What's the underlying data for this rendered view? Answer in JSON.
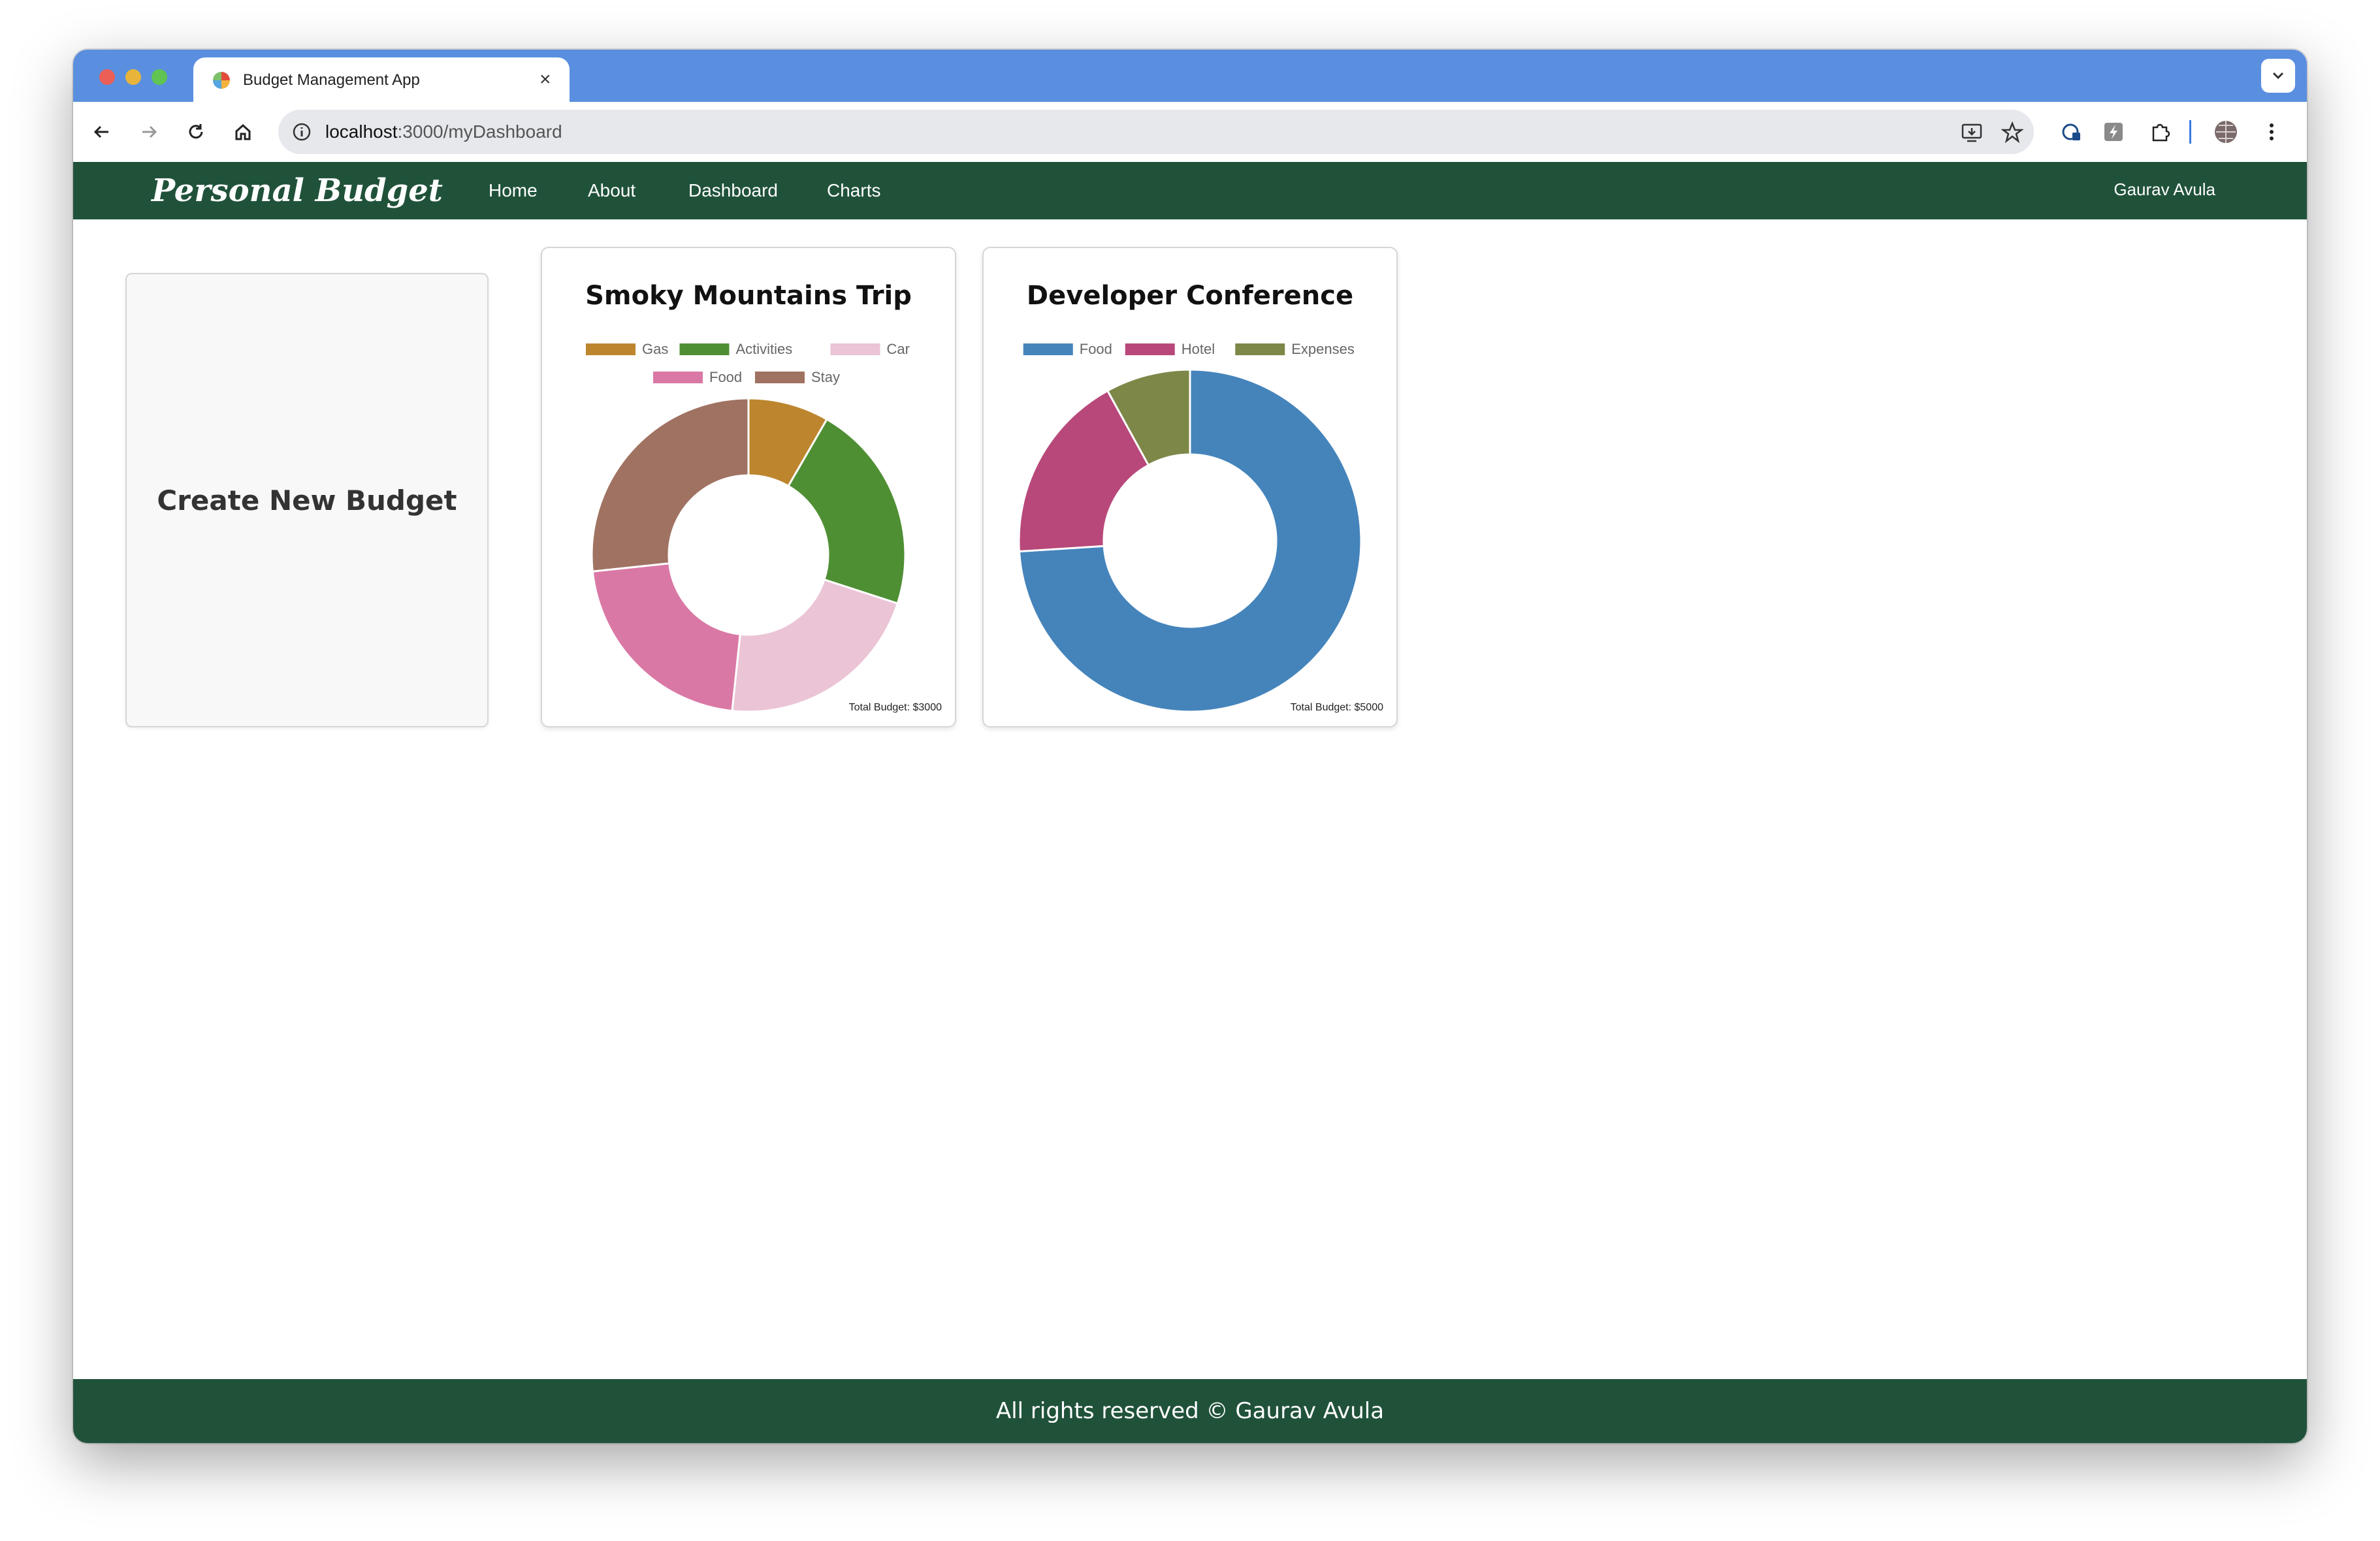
{
  "browser": {
    "tab_title": "Budget Management App",
    "url_host": "localhost",
    "url_path": ":3000/myDashboard"
  },
  "navbar": {
    "brand": "Personal Budget",
    "links": [
      "Home",
      "About",
      "Dashboard",
      "Charts"
    ],
    "user": "Gaurav Avula"
  },
  "create_card": {
    "label": "Create New Budget"
  },
  "budgets": [
    {
      "title": "Smoky Mountains Trip",
      "total": "Total Budget: $3000"
    },
    {
      "title": "Developer Conference",
      "total": "Total Budget: $5000"
    }
  ],
  "chart_data": [
    {
      "type": "pie",
      "title": "Smoky Mountains Trip",
      "categories": [
        "Gas",
        "Activities",
        "Car",
        "Food",
        "Stay"
      ],
      "values": [
        250,
        650,
        650,
        650,
        800
      ],
      "colors": [
        "#bd862e",
        "#4f8f34",
        "#ebc4d6",
        "#da78a5",
        "#a07261"
      ],
      "legend": "top"
    },
    {
      "type": "pie",
      "title": "Developer Conference",
      "categories": [
        "Food",
        "Hotel",
        "Expenses"
      ],
      "values": [
        3700,
        900,
        400
      ],
      "colors": [
        "#4584bb",
        "#b8487a",
        "#7d8748"
      ],
      "legend": "top"
    }
  ],
  "footer": {
    "text": "All rights reserved © Gaurav Avula"
  }
}
